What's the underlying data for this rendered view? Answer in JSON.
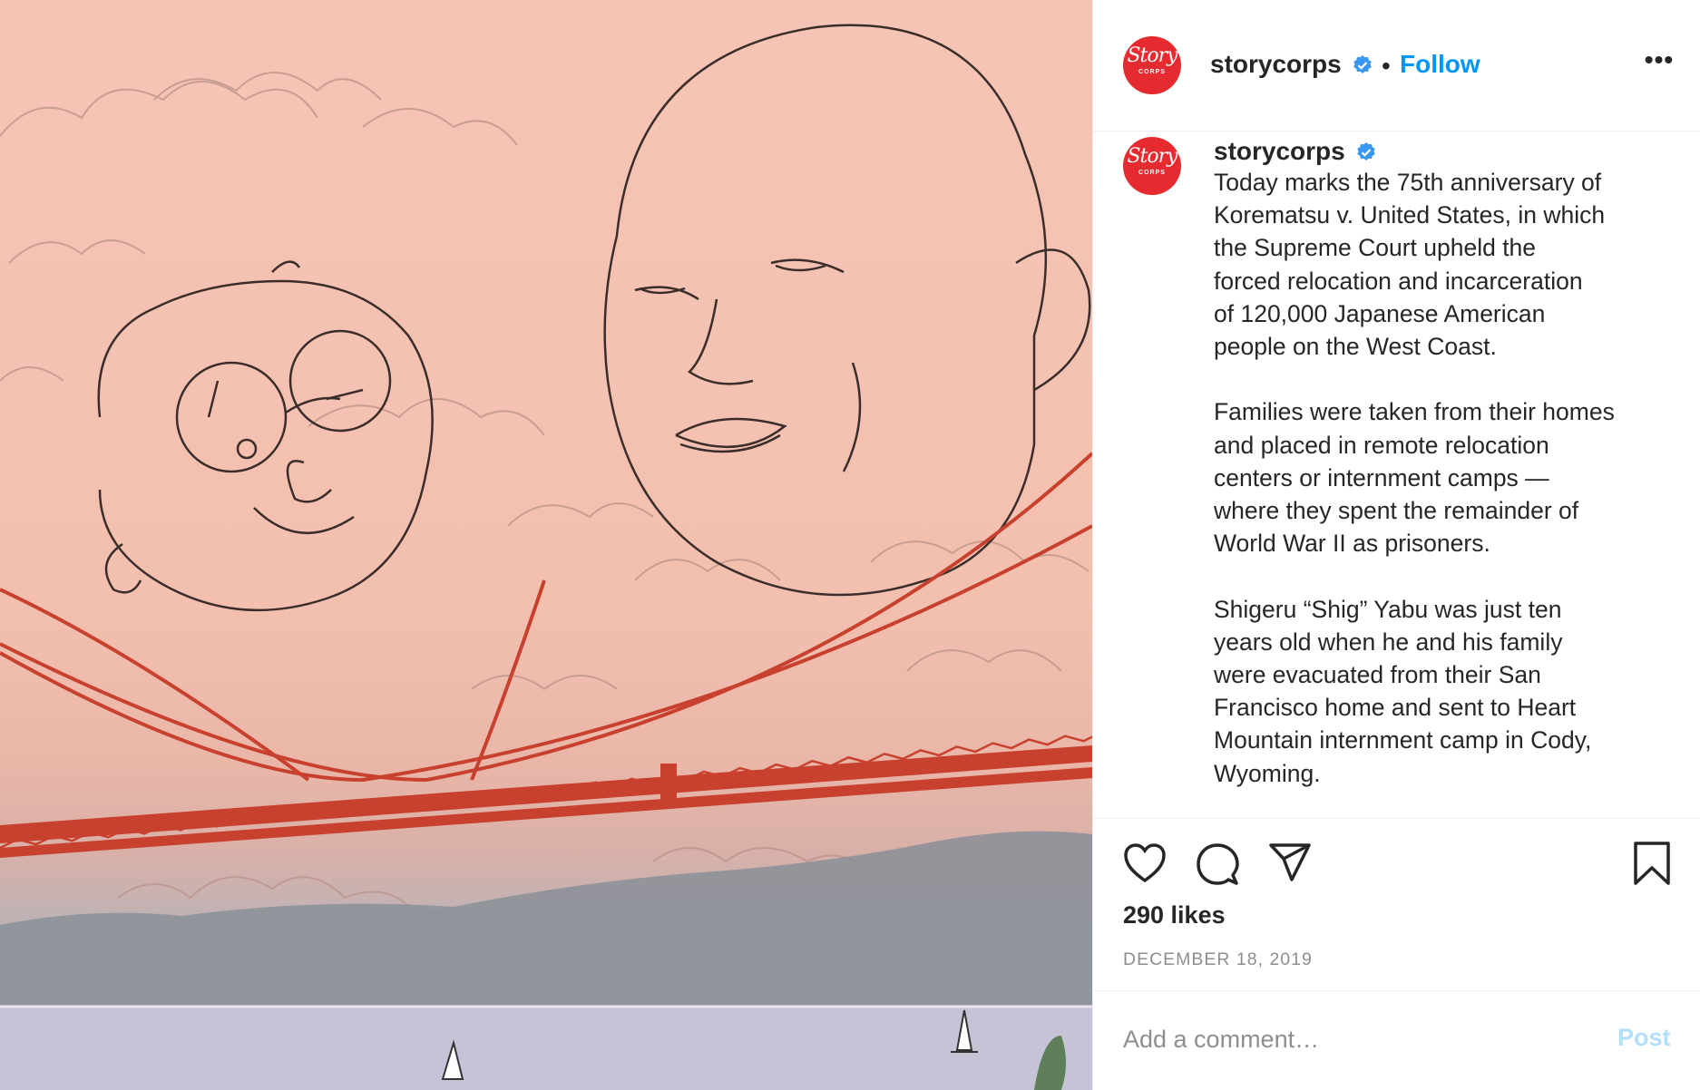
{
  "post": {
    "account": {
      "username": "storycorps",
      "verified": true,
      "logo_text": "Story",
      "logo_subtext": "CORPS",
      "avatar_color": "#e52b2f"
    },
    "header": {
      "separator": "•",
      "follow_label": "Follow",
      "more_icon": "more-options-icon",
      "more_label": "•••"
    },
    "caption": {
      "username": "storycorps",
      "text": "Today marks the 75th anniversary of\nKorematsu v. United States, in which\nthe Supreme Court upheld the\nforced relocation and incarceration\nof 120,000 Japanese American\npeople on the West Coast.\n\nFamilies were taken from their homes\nand placed in remote relocation\ncenters or internment camps —\nwhere they spent the remainder of\nWorld War II as prisoners.\n\nShigeru “Shig” Yabu was just ten\nyears old when he and his family\nwere evacuated from their San\nFrancisco home and sent to Heart\nMountain internment camp in Cody,\nWyoming."
    },
    "actions": {
      "like_icon": "heart-icon",
      "comment_icon": "comment-icon",
      "share_icon": "share-icon",
      "save_icon": "bookmark-icon"
    },
    "likes_text": "290 likes",
    "date_text": "DECEMBER 18, 2019",
    "comment_box": {
      "placeholder": "Add a comment…",
      "post_label": "Post"
    },
    "colors": {
      "link_blue": "#0095f6",
      "post_disabled": "#b2dffc",
      "verified_blue": "#3897f0",
      "bridge_red": "#c8412e"
    }
  }
}
